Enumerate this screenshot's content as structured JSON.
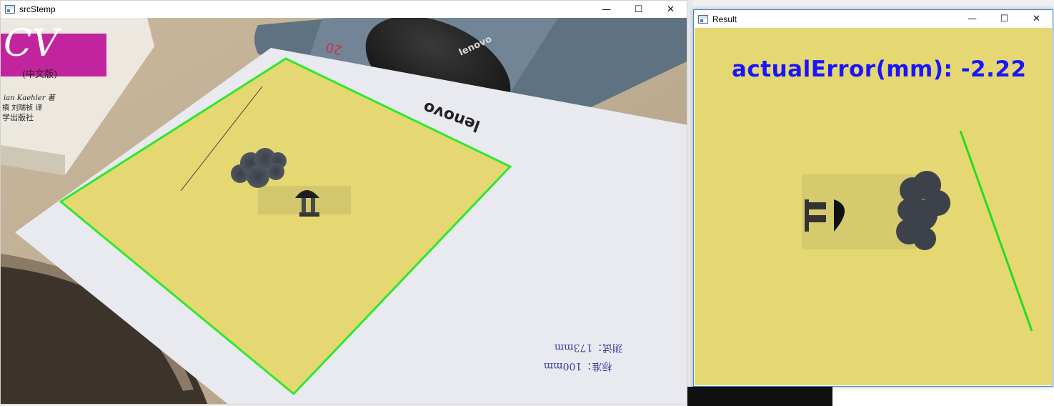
{
  "windows": {
    "source": {
      "title": "srcStemp",
      "controls": {
        "minimize": "—",
        "maximize": "☐",
        "close": "✕"
      },
      "photo": {
        "book_cover_text": "CV",
        "book_subtitle": "(中文版)",
        "book_author": "ian Kaehler 著",
        "book_translator": "禛 刘瑞祯 译",
        "book_publisher": "学出版社",
        "mouse_brand": "lenovo",
        "mousepad_brand": "lenovo",
        "mousepad_number": "20",
        "handwritten_note_line1": "标准：100mm",
        "handwritten_note_line2": "测试：173mm"
      },
      "detection_color": "#2ee82e",
      "paper_color": "#e5d873"
    },
    "result": {
      "title": "Result",
      "controls": {
        "minimize": "—",
        "maximize": "☐",
        "close": "✕"
      },
      "error_text": "actualError(mm):  -2.22",
      "line_color": "#22dd22",
      "text_color": "#1a14ff"
    }
  }
}
